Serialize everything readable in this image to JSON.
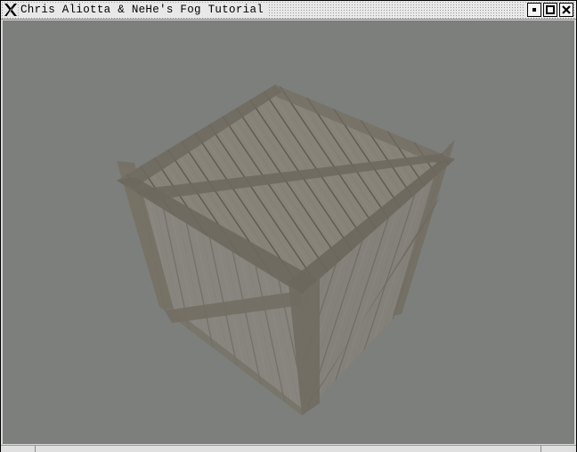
{
  "window": {
    "title": "Chris Aliotta & NeHe's Fog Tutorial",
    "controls": {
      "iconify": "iconify",
      "maximize": "maximize",
      "close": "close"
    }
  },
  "icons": {
    "logo": "x-logo-icon",
    "iconify": "square-dot-icon",
    "maximize": "square-outline-icon",
    "close": "x-close-icon"
  },
  "scene": {
    "object": "textured wooden crate",
    "fog_color": "#7c7f7b"
  }
}
